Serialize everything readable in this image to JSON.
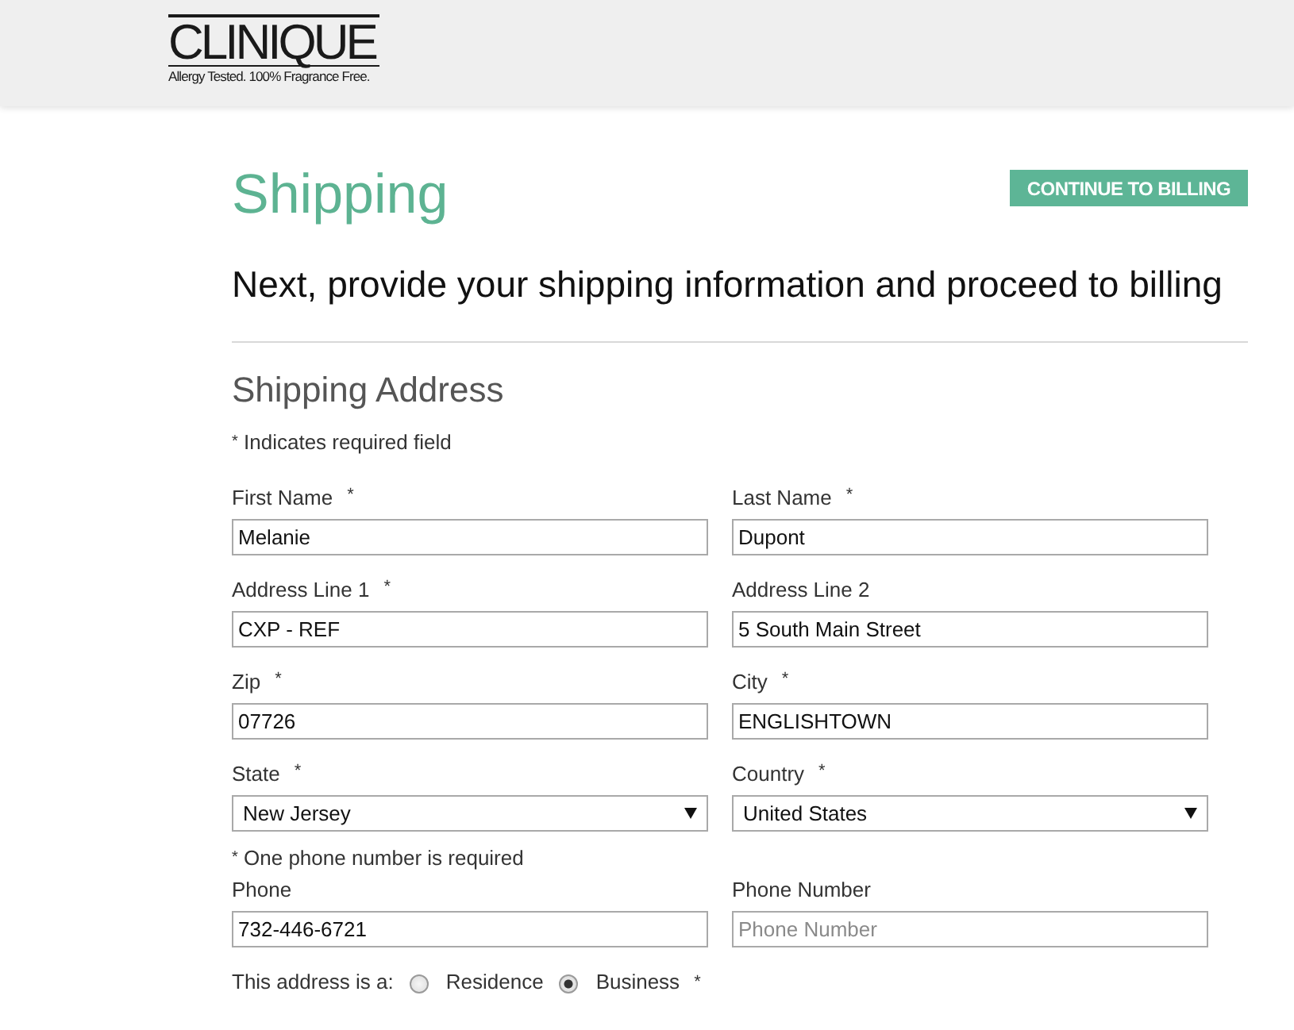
{
  "header": {
    "logo": {
      "wordmark": "CLINIQUE",
      "tagline": "Allergy Tested. 100% Fragrance Free."
    }
  },
  "page": {
    "title": "Shipping",
    "action_button": "CONTINUE TO BILLING",
    "subtitle": "Next, provide your shipping information and proceed to billing"
  },
  "shipping_address": {
    "heading": "Shipping Address",
    "required_note": "$^{*}$ Indicates required field",
    "rows": [
      {
        "fields": [
          {
            "label": "First Name",
            "required_mark": "*",
            "kind": "text",
            "value": "Melanie"
          },
          {
            "label": "Last Name",
            "required_mark": "*",
            "kind": "text",
            "value": "Dupont"
          }
        ]
      },
      {
        "fields": [
          {
            "label": "Address Line 1",
            "required_mark": "*",
            "kind": "text",
            "value": "CXP - REF"
          },
          {
            "label": "Address Line 2",
            "kind": "text",
            "value": "5 South Main Street"
          }
        ]
      },
      {
        "fields": [
          {
            "label": "Zip",
            "required_mark": "*",
            "kind": "text",
            "value": "07726"
          },
          {
            "label": "City",
            "required_mark": "*",
            "kind": "text",
            "value": "ENGLISHTOWN"
          }
        ]
      },
      {
        "fields": [
          {
            "label": "State",
            "required_mark": "*",
            "kind": "select",
            "value": "New Jersey"
          },
          {
            "label": "Country",
            "required_mark": "*",
            "kind": "select",
            "value": "United States"
          }
        ]
      },
      {
        "note": "$^{*}$ One phone number is required",
        "fields": [
          {
            "label": "Phone",
            "kind": "text",
            "value": "732-446-6721"
          },
          {
            "label": "Phone Number",
            "kind": "text",
            "placeholder": "Phone Number"
          }
        ]
      }
    ],
    "address_type": {
      "label": "This address is a:",
      "options": [
        {
          "label": "Residence",
          "selected": false
        },
        {
          "label": "Business",
          "selected": true
        }
      ],
      "required_mark": "*"
    }
  }
}
